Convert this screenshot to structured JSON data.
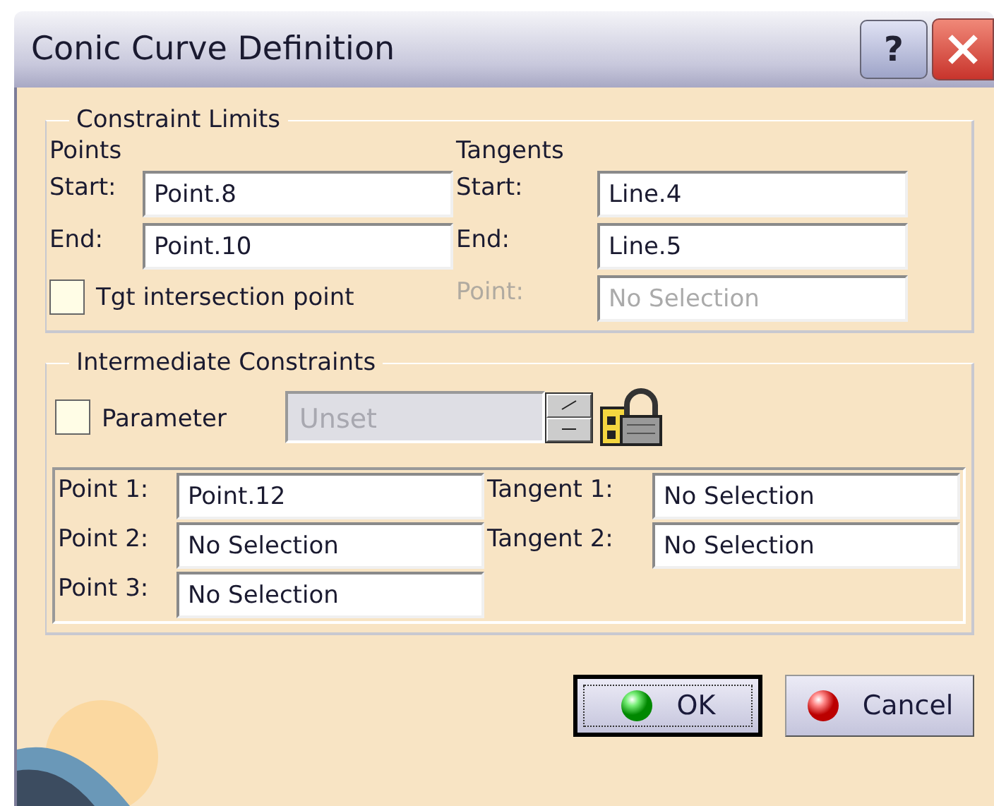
{
  "window": {
    "title": "Conic Curve Definition",
    "help": "?"
  },
  "constraint_limits": {
    "title": "Constraint Limits",
    "points": {
      "heading": "Points",
      "rows": [
        {
          "label": "Start:",
          "value": "Point.8"
        },
        {
          "label": "End:",
          "value": "Point.10"
        }
      ]
    },
    "tangents": {
      "heading": "Tangents",
      "rows": [
        {
          "label": "Start:",
          "value": "Line.4",
          "disabled": false
        },
        {
          "label": "End:",
          "value": "Line.5",
          "disabled": false
        },
        {
          "label": "Point:",
          "value": "No Selection",
          "disabled": true
        }
      ]
    },
    "tgt_intersection": {
      "label": "Tgt intersection point",
      "checked": false
    }
  },
  "intermediate_constraints": {
    "title": "Intermediate Constraints",
    "parameter": {
      "label": "Parameter",
      "checked": false,
      "value": "Unset",
      "disabled": true
    },
    "points": [
      {
        "label": "Point 1:",
        "value": "Point.12"
      },
      {
        "label": "Point 2:",
        "value": "No Selection"
      },
      {
        "label": "Point 3:",
        "value": "No Selection"
      }
    ],
    "tangents": [
      {
        "label": "Tangent 1:",
        "value": "No Selection"
      },
      {
        "label": "Tangent 2:",
        "value": "No Selection"
      }
    ]
  },
  "buttons": [
    {
      "label": "OK",
      "kind": "ok",
      "focused": true
    },
    {
      "label": "Cancel",
      "kind": "cancel",
      "focused": false
    }
  ]
}
